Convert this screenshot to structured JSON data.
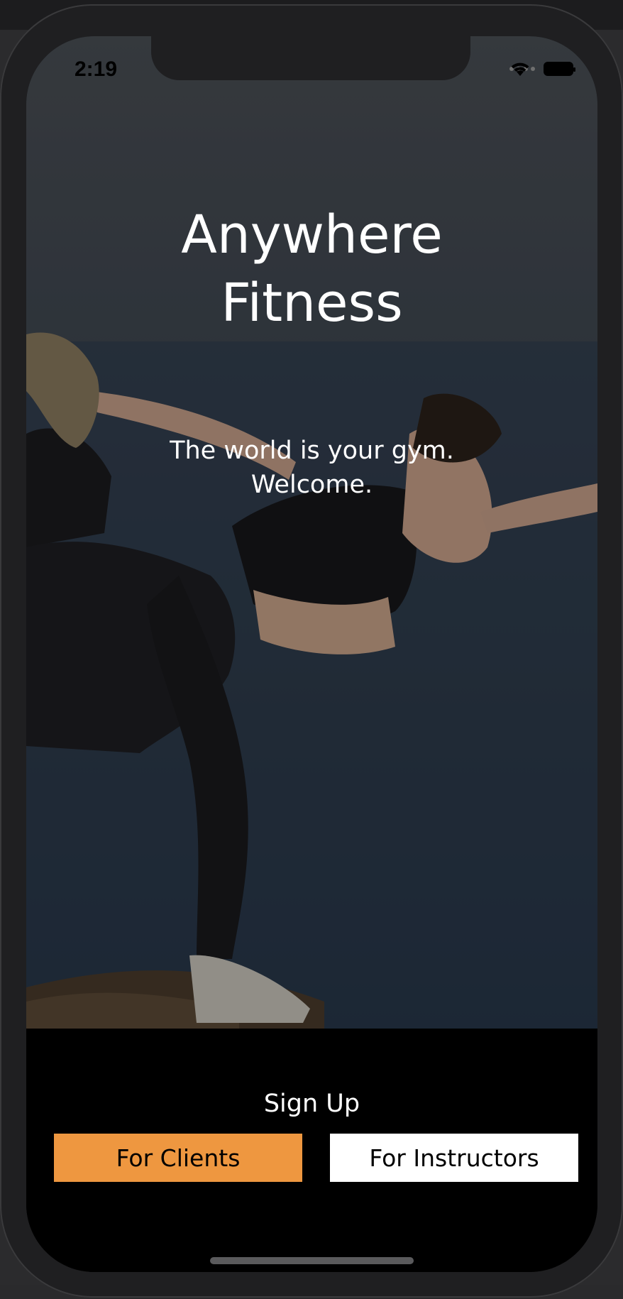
{
  "status_bar": {
    "time": "2:19",
    "icons": [
      "cellular-signal-icon",
      "wifi-icon",
      "battery-icon"
    ]
  },
  "hero": {
    "title_line1": "Anywhere",
    "title_line2": "Fitness",
    "tagline_line1": "The world is your gym.",
    "tagline_line2": "Welcome."
  },
  "signup": {
    "heading": "Sign Up",
    "clients_label": "For Clients",
    "instructors_label": "For Instructors"
  },
  "colors": {
    "accent": "#ee9740",
    "panel_background": "#000000",
    "secondary_button": "#ffffff"
  }
}
